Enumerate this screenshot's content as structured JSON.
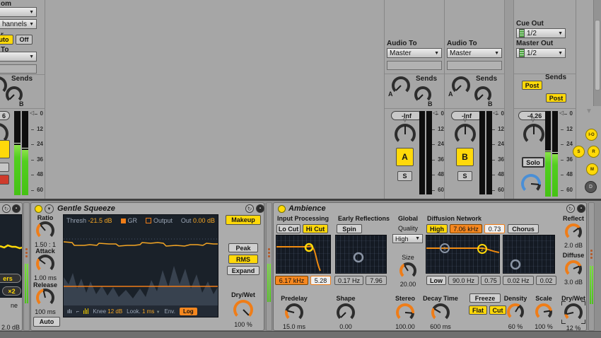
{
  "mixer": {
    "db_scale": [
      "0",
      "12",
      "24",
      "36",
      "48",
      "60"
    ],
    "left": {
      "from_fragment": "om",
      "channels_fragment": "hannels",
      "monitor_fragment": "r",
      "auto_label": "uto",
      "off_label": "Off",
      "to_fragment": "To",
      "sends_label": "Sends",
      "send_b": "B",
      "fader_fragment": "6"
    },
    "tracks": [
      {
        "audio_to_label": "Audio To",
        "routing": "Master",
        "sends_label": "Sends",
        "send_a": "A",
        "send_b": "B",
        "fader_value": "-Inf",
        "activator": "A",
        "solo_label": "S"
      },
      {
        "audio_to_label": "Audio To",
        "routing": "Master",
        "sends_label": "Sends",
        "send_a": "A",
        "send_b": "B",
        "fader_value": "-Inf",
        "activator": "B",
        "solo_label": "S"
      }
    ],
    "master": {
      "cue_out_label": "Cue Out",
      "cue_routing": "1/2",
      "master_out_label": "Master Out",
      "master_routing": "1/2",
      "sends_label": "Sends",
      "post_a": "Post",
      "post_b": "Post",
      "fader_value": "-4.26",
      "solo_label": "Solo"
    },
    "view_toggles": {
      "io": "I-O",
      "sends": "S",
      "returns": "R",
      "mixer": "M",
      "delay": "D",
      "crossfader": "×"
    }
  },
  "devices": {
    "partial_left": {
      "pill_top": "ers",
      "pill_bottom": "×2",
      "label_fragment": "ne",
      "value_fragment": "2.0 dB"
    },
    "compressor": {
      "title": "Gentle Squeeze",
      "display": {
        "thresh_label": "Thresh",
        "thresh_value": "-21.5 dB",
        "gr_label": "GR",
        "output_label": "Output",
        "out_label": "Out",
        "out_value": "0.00 dB"
      },
      "toolbar": {
        "knee_label": "Knee",
        "knee_value": "12 dB",
        "look_label": "Look.",
        "look_value": "1 ms",
        "env_label": "Env.",
        "env_mode": "Log"
      },
      "buttons": {
        "makeup": "Makeup",
        "peak": "Peak",
        "rms": "RMS",
        "expand": "Expand",
        "auto": "Auto"
      },
      "knobs": {
        "ratio": {
          "label": "Ratio",
          "value": "1.50 : 1"
        },
        "attack": {
          "label": "Attack",
          "value": "1.00 ms"
        },
        "release": {
          "label": "Release",
          "value": "100 ms"
        },
        "drywet": {
          "label": "Dry/Wet",
          "value": "100 %"
        }
      }
    },
    "reverb": {
      "title": "Ambience",
      "input": {
        "section": "Input Processing",
        "lo_cut": "Lo Cut",
        "hi_cut": "Hi Cut",
        "freq": "6.17 kHz",
        "q": "5.28"
      },
      "early": {
        "section": "Early Reflections",
        "spin": "Spin",
        "rate": "0.17 Hz",
        "amount": "7.96"
      },
      "global": {
        "section": "Global",
        "quality_label": "Quality",
        "quality_value": "High",
        "size_label": "Size",
        "size_value": "20.00"
      },
      "diffusion": {
        "section": "Diffusion Network",
        "high": "High",
        "hi_freq": "7.06 kHz",
        "hi_q": "0.73",
        "chorus": "Chorus",
        "low": "Low",
        "lo_freq": "90.0 Hz",
        "lo_q": "0.75",
        "chorus_rate": "0.02 Hz",
        "chorus_amount": "0.02"
      },
      "freeze": {
        "freeze": "Freeze",
        "flat": "Flat",
        "cut": "Cut"
      },
      "knobs": {
        "reflect": {
          "label": "Reflect",
          "value": "2.0 dB"
        },
        "diffuse": {
          "label": "Diffuse",
          "value": "3.0 dB"
        },
        "predelay": {
          "label": "Predelay",
          "value": "15.0 ms"
        },
        "shape": {
          "label": "Shape",
          "value": "0.00"
        },
        "stereo": {
          "label": "Stereo",
          "value": "100.00"
        },
        "decay": {
          "label": "Decay Time",
          "value": "600 ms"
        },
        "density": {
          "label": "Density",
          "value": "60 %"
        },
        "scale": {
          "label": "Scale",
          "value": "100 %"
        },
        "drywet": {
          "label": "Dry/Wet",
          "value": "12 %"
        }
      }
    }
  }
}
